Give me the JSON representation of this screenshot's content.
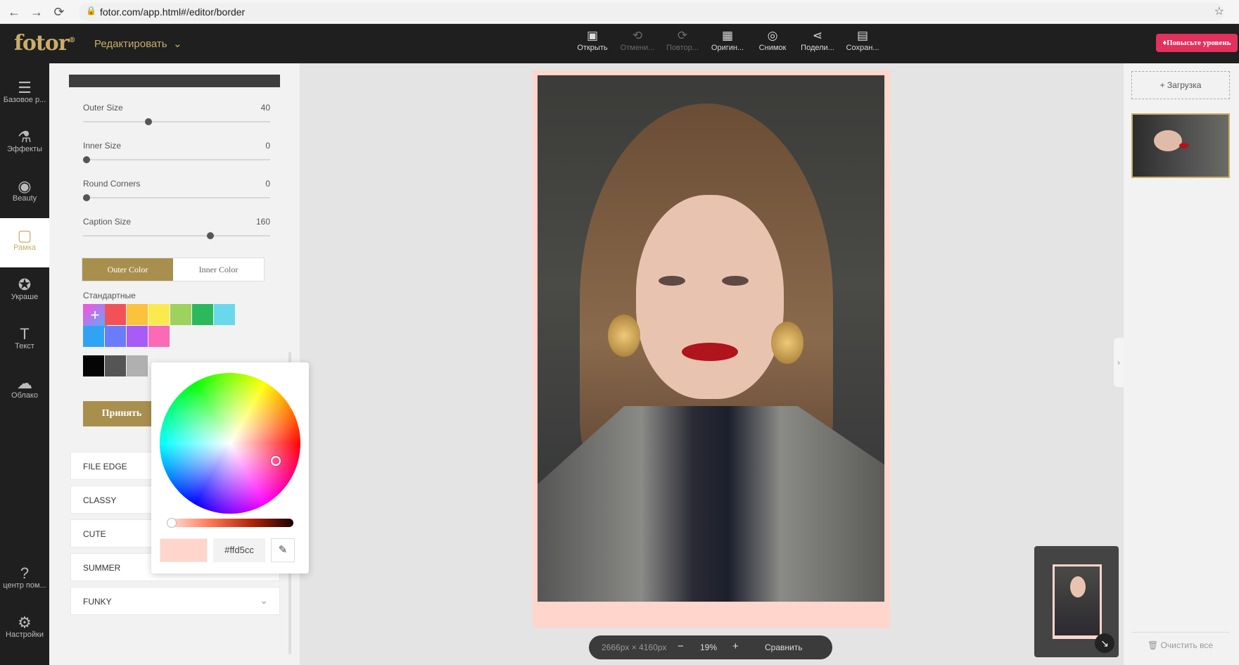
{
  "browser": {
    "url": "fotor.com/app.html#/editor/border",
    "back_icon": "←",
    "forward_icon": "→",
    "reload_icon": "⟳",
    "star_icon": "☆"
  },
  "header": {
    "logo": "fotor",
    "logo_mark": "®",
    "edit_menu": "Редактировать",
    "upgrade": "Повысьте уровень",
    "toolbar": [
      {
        "icon": "▣",
        "label": "Открыть",
        "enabled": true
      },
      {
        "icon": "⟲",
        "label": "Отмени...",
        "enabled": false
      },
      {
        "icon": "⟳",
        "label": "Повтор...",
        "enabled": false
      },
      {
        "icon": "▦",
        "label": "Оригин...",
        "enabled": true
      },
      {
        "icon": "◎",
        "label": "Снимок",
        "enabled": true
      },
      {
        "icon": "⋖",
        "label": "Подели...",
        "enabled": true
      },
      {
        "icon": "▤",
        "label": "Сохран...",
        "enabled": true
      }
    ]
  },
  "rail": [
    {
      "icon": "☰",
      "label": "Базовое р...",
      "active": false
    },
    {
      "icon": "⚗",
      "label": "Эффекты",
      "active": false
    },
    {
      "icon": "◉",
      "label": "Beauty",
      "active": false
    },
    {
      "icon": "▢",
      "label": "Рамка",
      "active": true
    },
    {
      "icon": "✪",
      "label": "Украше",
      "active": false
    },
    {
      "icon": "T",
      "label": "Текст",
      "active": false
    },
    {
      "icon": "☁",
      "label": "Облако",
      "active": false
    },
    {
      "icon": "?",
      "label": "центр пом...",
      "active": false
    },
    {
      "icon": "⚙",
      "label": "Настройки",
      "active": false
    }
  ],
  "panel": {
    "sliders": [
      {
        "label": "Outer Size",
        "value": "40",
        "fraction": 0.35
      },
      {
        "label": "Inner Size",
        "value": "0",
        "fraction": 0.02
      },
      {
        "label": "Round Corners",
        "value": "0",
        "fraction": 0.02
      },
      {
        "label": "Caption Size",
        "value": "160",
        "fraction": 0.68
      }
    ],
    "tabs": {
      "outer": "Outer Color",
      "inner": "Inner Color"
    },
    "standard_label": "Стандартные",
    "plus_icon": "+",
    "swatches_row1": [
      "#f25257",
      "#fcc23c",
      "#fbea4e",
      "#9ed25e",
      "#2cb85c",
      "#6ad8ec"
    ],
    "swatches_row2": [
      "#31a3f5",
      "#6b7cfb",
      "#a85cf5",
      "#fb6ab5"
    ],
    "swatches_row3": [
      "#050505",
      "#555555",
      "#b0b0b0"
    ],
    "accept": "Принять",
    "categories": [
      "FILE EDGE",
      "CLASSY",
      "CUTE",
      "SUMMER",
      "FUNKY"
    ],
    "chevron_icon": "⌄"
  },
  "picker": {
    "hex": "#ffd5cc",
    "preview_color": "#ffd5cc",
    "eyedropper_icon": "✎"
  },
  "canvas": {
    "frame_color": "#ffd5cc",
    "collapse_icon": "›"
  },
  "status": {
    "dimensions": "2666px × 4160px",
    "minus": "−",
    "zoom": "19%",
    "plus": "+",
    "compare": "Сравнить"
  },
  "navigator": {
    "expand_icon": "↘"
  },
  "right": {
    "upload": "+ Загрузка",
    "clear_all": "🗑 Очистить все"
  }
}
